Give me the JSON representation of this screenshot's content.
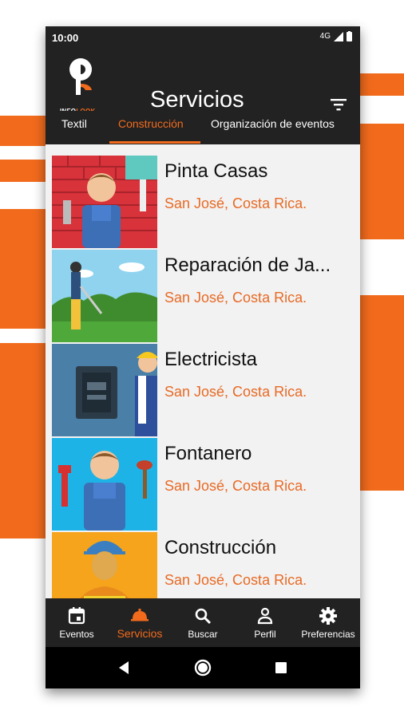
{
  "status": {
    "time": "10:00",
    "network": "4G"
  },
  "app": {
    "title": "Servicios",
    "logo_brand": "INFO",
    "logo_brand_accent": "LOOK"
  },
  "tabs": [
    {
      "label": "Textil"
    },
    {
      "label": "Construcción"
    },
    {
      "label": "Organización de eventos"
    }
  ],
  "items": [
    {
      "name": "Pinta Casas",
      "location": "San José, Costa Rica."
    },
    {
      "name": "Reparación de Ja...",
      "location": "San José, Costa Rica."
    },
    {
      "name": "Electricista",
      "location": "San José, Costa Rica."
    },
    {
      "name": "Fontanero",
      "location": "San José, Costa Rica."
    },
    {
      "name": "Construcción",
      "location": "San José, Costa Rica."
    }
  ],
  "nav": [
    {
      "label": "Eventos",
      "icon": "calendar-icon"
    },
    {
      "label": "Servicios",
      "icon": "service-bell-icon"
    },
    {
      "label": "Buscar",
      "icon": "search-icon"
    },
    {
      "label": "Perfil",
      "icon": "person-icon"
    },
    {
      "label": "Preferencias",
      "icon": "gear-icon"
    }
  ],
  "colors": {
    "accent": "#f26b1d",
    "dark": "#222222",
    "list_bg": "#f2f2f2"
  }
}
